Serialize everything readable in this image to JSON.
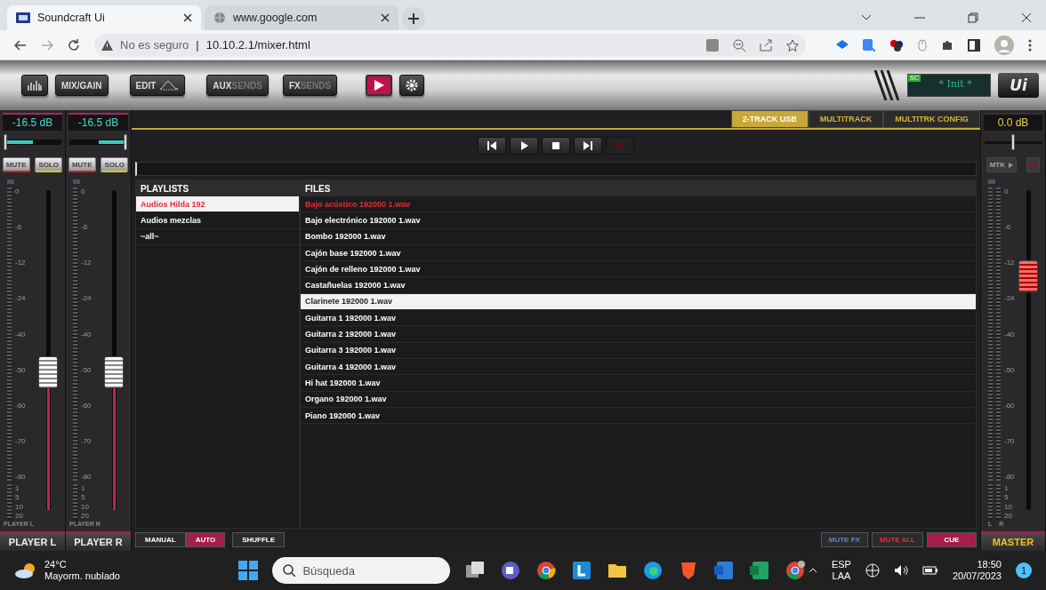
{
  "browser": {
    "tabs": [
      {
        "title": "Soundcraft Ui",
        "selected": true
      },
      {
        "title": "www.google.com",
        "selected": false
      }
    ],
    "security": "No es seguro",
    "separator": "|",
    "url": "10.10.2.1/mixer.html"
  },
  "toolbar": {
    "buttons": [
      {
        "kind": "meters"
      },
      {
        "kind": "text",
        "label": "MIX/GAIN"
      },
      {
        "kind": "edit",
        "label": "EDIT"
      },
      {
        "kind": "text",
        "label": "AUX",
        "sublabel": "SENDS"
      },
      {
        "kind": "text",
        "label": "FX",
        "sublabel": "SENDS"
      },
      {
        "kind": "play",
        "selected": true
      },
      {
        "kind": "gear"
      }
    ],
    "show": "* Init *",
    "show_badge": "SC",
    "logo": "Ui"
  },
  "channels": [
    {
      "gain": "-16.5 dB",
      "pan": {
        "level": 0
      },
      "mute": "MUTE",
      "solo": "SOLO",
      "fader": {
        "level": 0.43
      },
      "scale": [
        "0",
        "-6",
        "-12",
        "-24",
        "-40",
        "-50",
        "-60",
        "-70",
        "-80"
      ],
      "sub_scale": [
        "1",
        "5",
        "10",
        "20"
      ],
      "label": "PLAYER L",
      "name": "PLAYER L"
    },
    {
      "gain": "-16.5 dB",
      "pan": {
        "level": 1
      },
      "mute": "MUTE",
      "solo": "SOLO",
      "fader": {
        "level": 0.43
      },
      "scale": [
        "0",
        "-6",
        "-12",
        "-24",
        "-40",
        "-50",
        "-60",
        "-70",
        "-80"
      ],
      "sub_scale": [
        "1",
        "5",
        "10",
        "20"
      ],
      "label": "PLAYER R",
      "name": "PLAYER R"
    }
  ],
  "player": {
    "tabs": [
      {
        "label": "2-TRACK USB",
        "selected": true
      },
      {
        "label": "MULTITRACK",
        "selected": false
      },
      {
        "label": "MULTITRK CONFIG",
        "selected": false
      }
    ],
    "transport": [
      {
        "kind": "prev",
        "disabled": false
      },
      {
        "kind": "play",
        "disabled": false
      },
      {
        "kind": "stop",
        "disabled": false
      },
      {
        "kind": "next",
        "disabled": false
      },
      {
        "kind": "record",
        "disabled": true
      }
    ],
    "playlists": {
      "heading": "PLAYLISTS",
      "items": [
        {
          "name": "Audios Hilda 192",
          "selected": true
        },
        {
          "name": "Audios mezclas",
          "selected": false
        },
        {
          "name": "~all~",
          "selected": false
        }
      ]
    },
    "files": {
      "heading": "FILES",
      "items": [
        {
          "name": "Bajo acústico 192000 1.wav",
          "playing": true,
          "selected": false
        },
        {
          "name": "Bajo electrónico 192000 1.wav",
          "playing": false,
          "selected": false
        },
        {
          "name": "Bombo 192000 1.wav",
          "playing": false,
          "selected": false
        },
        {
          "name": "Cajón base 192000 1.wav",
          "playing": false,
          "selected": false
        },
        {
          "name": "Cajón de relleno 192000 1.wav",
          "playing": false,
          "selected": false
        },
        {
          "name": "Castañuelas 192000 1.wav",
          "playing": false,
          "selected": false
        },
        {
          "name": "Clarinete 192000 1.wav",
          "playing": false,
          "selected": true
        },
        {
          "name": "Guitarra 1 192000 1.wav",
          "playing": false,
          "selected": false
        },
        {
          "name": "Guitarra 2 192000 1.wav",
          "playing": false,
          "selected": false
        },
        {
          "name": "Guitarra 3 192000 1.wav",
          "playing": false,
          "selected": false
        },
        {
          "name": "Guitarra 4 192000 1.wav",
          "playing": false,
          "selected": false
        },
        {
          "name": "Hi hat 192000 1.wav",
          "playing": false,
          "selected": false
        },
        {
          "name": "Organo 192000 1.wav",
          "playing": false,
          "selected": false
        },
        {
          "name": "Piano 192000 1.wav",
          "playing": false,
          "selected": false
        }
      ]
    },
    "modes": [
      {
        "label": "MANUAL",
        "selected": false
      },
      {
        "label": "AUTO",
        "selected": true
      },
      {
        "label": "SHUFFLE",
        "selected": false
      }
    ],
    "actions": [
      {
        "kind": "fx",
        "label": "MUTE FX",
        "on": false
      },
      {
        "kind": "all",
        "label": "MUTE ALL",
        "on": false
      },
      {
        "kind": "cue",
        "label": "CUE",
        "on": true
      }
    ]
  },
  "master": {
    "gain": "0.0 dB",
    "balance": {
      "level": 0.5
    },
    "mtk": "MTK",
    "mtk_disabled": true,
    "fader": {
      "level": 0.73
    },
    "scale": [
      "0",
      "-6",
      "-12",
      "-24",
      "-40",
      "-50",
      "-60",
      "-70",
      "-80"
    ],
    "sub_scale": [
      "1",
      "5",
      "10",
      "20"
    ],
    "left": "L",
    "right": "R",
    "name": "MASTER"
  },
  "taskbar": {
    "temperature": "24°C",
    "weather": "Mayorm. nublado",
    "search_placeholder": "Búsqueda",
    "lang": "ESP",
    "layout": "LAA",
    "time": "18:50",
    "date": "20/07/2023",
    "notifications": "1"
  }
}
